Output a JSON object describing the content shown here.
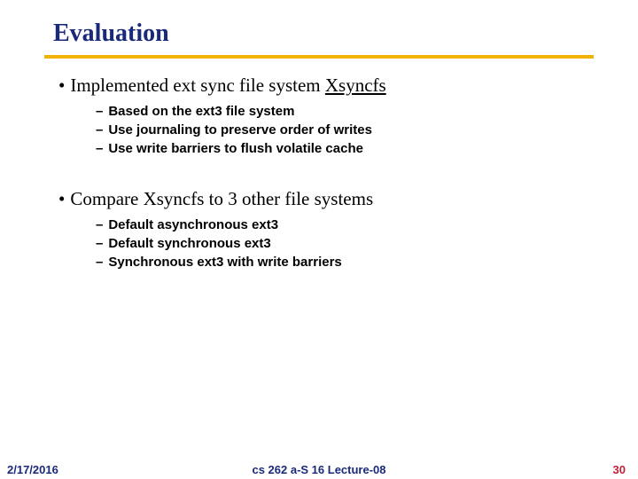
{
  "title": "Evaluation",
  "bullets": {
    "b1": {
      "prefix": "•",
      "text_a": "Implemented ext sync file system ",
      "text_u": "Xsyncfs",
      "sub": {
        "s1": {
          "prefix": "–",
          "text": "Based on the ext3 file system"
        },
        "s2": {
          "prefix": "–",
          "text": "Use journaling to preserve order of writes"
        },
        "s3": {
          "prefix": "–",
          "text": "Use write barriers to flush volatile cache"
        }
      }
    },
    "b2": {
      "prefix": "•",
      "text": "Compare Xsyncfs to 3 other file systems",
      "sub": {
        "s1": {
          "prefix": "–",
          "text": "Default asynchronous ext3"
        },
        "s2": {
          "prefix": "–",
          "text": "Default synchronous ext3"
        },
        "s3": {
          "prefix": "–",
          "text": "Synchronous ext3 with write barriers"
        }
      }
    }
  },
  "footer": {
    "date": "2/17/2016",
    "center": "cs 262 a-S 16 Lecture-08",
    "page": "30"
  }
}
